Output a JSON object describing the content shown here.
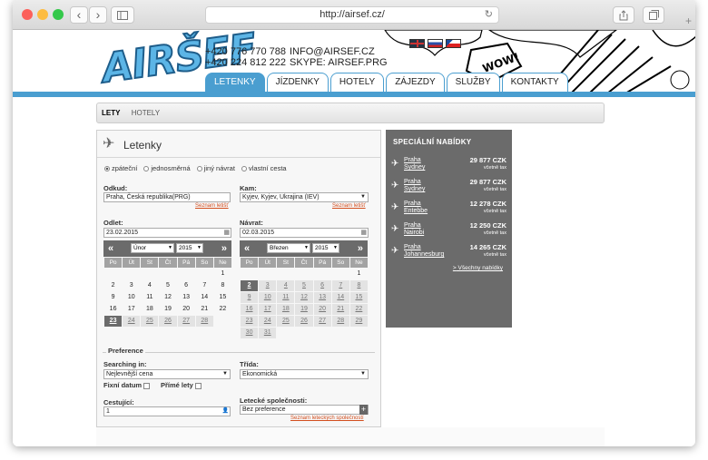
{
  "browser": {
    "url": "http://airsef.cz/",
    "back": "‹",
    "forward": "›"
  },
  "site": {
    "logo": "AIRŠEF",
    "phone1": "+420 776 770 788",
    "phone2": "+420 224 812 222",
    "email": "INFO@AIRSEF.CZ",
    "skype": "SKYPE: AIRSEF.PRG",
    "wow": "WOW!",
    "tabs": [
      "LETENKY",
      "JÍZDENKY",
      "HOTELY",
      "ZÁJEZDY",
      "SLUŽBY",
      "KONTAKTY"
    ]
  },
  "subnav": [
    "LETY",
    "HOTELY"
  ],
  "form": {
    "title": "Letenky",
    "radios": [
      "zpáteční",
      "jednosměrná",
      "jiný návrat",
      "vlastní cesta"
    ],
    "from_label": "Odkud:",
    "from_value": "Praha, Česká republika(PRG)",
    "to_label": "Kam:",
    "to_value": "Kyjev, Kyjev, Ukrajina (IEV)",
    "airports_link": "Seznam letišť",
    "dep_label": "Odlet:",
    "dep_value": "23.02.2015",
    "ret_label": "Návrat:",
    "ret_value": "02.03.2015",
    "prev": "«",
    "next": "»",
    "cal1_month": "Únor",
    "cal1_year": "2015",
    "cal2_month": "Březen",
    "cal2_year": "2015",
    "weekdays": [
      "Po",
      "Út",
      "St",
      "Čt",
      "Pá",
      "So",
      "Ne"
    ],
    "cal1_rows": [
      [
        "",
        "",
        "",
        "",
        "",
        "",
        "1"
      ],
      [
        "2",
        "3",
        "4",
        "5",
        "6",
        "7",
        "8"
      ],
      [
        "9",
        "10",
        "11",
        "12",
        "13",
        "14",
        "15"
      ],
      [
        "16",
        "17",
        "18",
        "19",
        "20",
        "21",
        "22"
      ],
      [
        "23",
        "24",
        "25",
        "26",
        "27",
        "28",
        ""
      ]
    ],
    "cal2_rows": [
      [
        "",
        "",
        "",
        "",
        "",
        "",
        "1"
      ],
      [
        "2",
        "3",
        "4",
        "5",
        "6",
        "7",
        "8"
      ],
      [
        "9",
        "10",
        "11",
        "12",
        "13",
        "14",
        "15"
      ],
      [
        "16",
        "17",
        "18",
        "19",
        "20",
        "21",
        "22"
      ],
      [
        "23",
        "24",
        "25",
        "26",
        "27",
        "28",
        "29"
      ],
      [
        "30",
        "31",
        "",
        "",
        "",
        "",
        ""
      ]
    ],
    "pref_title": "Preference",
    "searching_label": "Searching in:",
    "searching_value": "Nejlevnější cena",
    "class_label": "Třída:",
    "class_value": "Ekonomická",
    "fixed_label": "Fixní datum",
    "direct_label": "Přímé lety",
    "pax_label": "Cestující:",
    "pax_value": "1",
    "airlines_label": "Letecké společnosti:",
    "airlines_value": "Bez preference",
    "airlines_link": "Seznam leteckých společností"
  },
  "special": {
    "title": "SPECIÁLNÍ NABÍDKY",
    "offers": [
      {
        "from": "Praha",
        "to": "Sydney",
        "price": "29 877 CZK",
        "tax": "včetně tax"
      },
      {
        "from": "Praha",
        "to": "Sydney",
        "price": "29 877 CZK",
        "tax": "včetně tax"
      },
      {
        "from": "Praha",
        "to": "Entebbe",
        "price": "12 278 CZK",
        "tax": "včetně tax"
      },
      {
        "from": "Praha",
        "to": "Nairobi",
        "price": "12 250 CZK",
        "tax": "včetně tax"
      },
      {
        "from": "Praha",
        "to": "Johannesburg",
        "price": "14 265 CZK",
        "tax": "včetně tax"
      }
    ],
    "all": "Všechny nabídky",
    "all_prefix": ">"
  },
  "colors": {
    "accent": "#4a9ed0",
    "panel": "#6b6b6b",
    "link": "#d24e1e"
  }
}
